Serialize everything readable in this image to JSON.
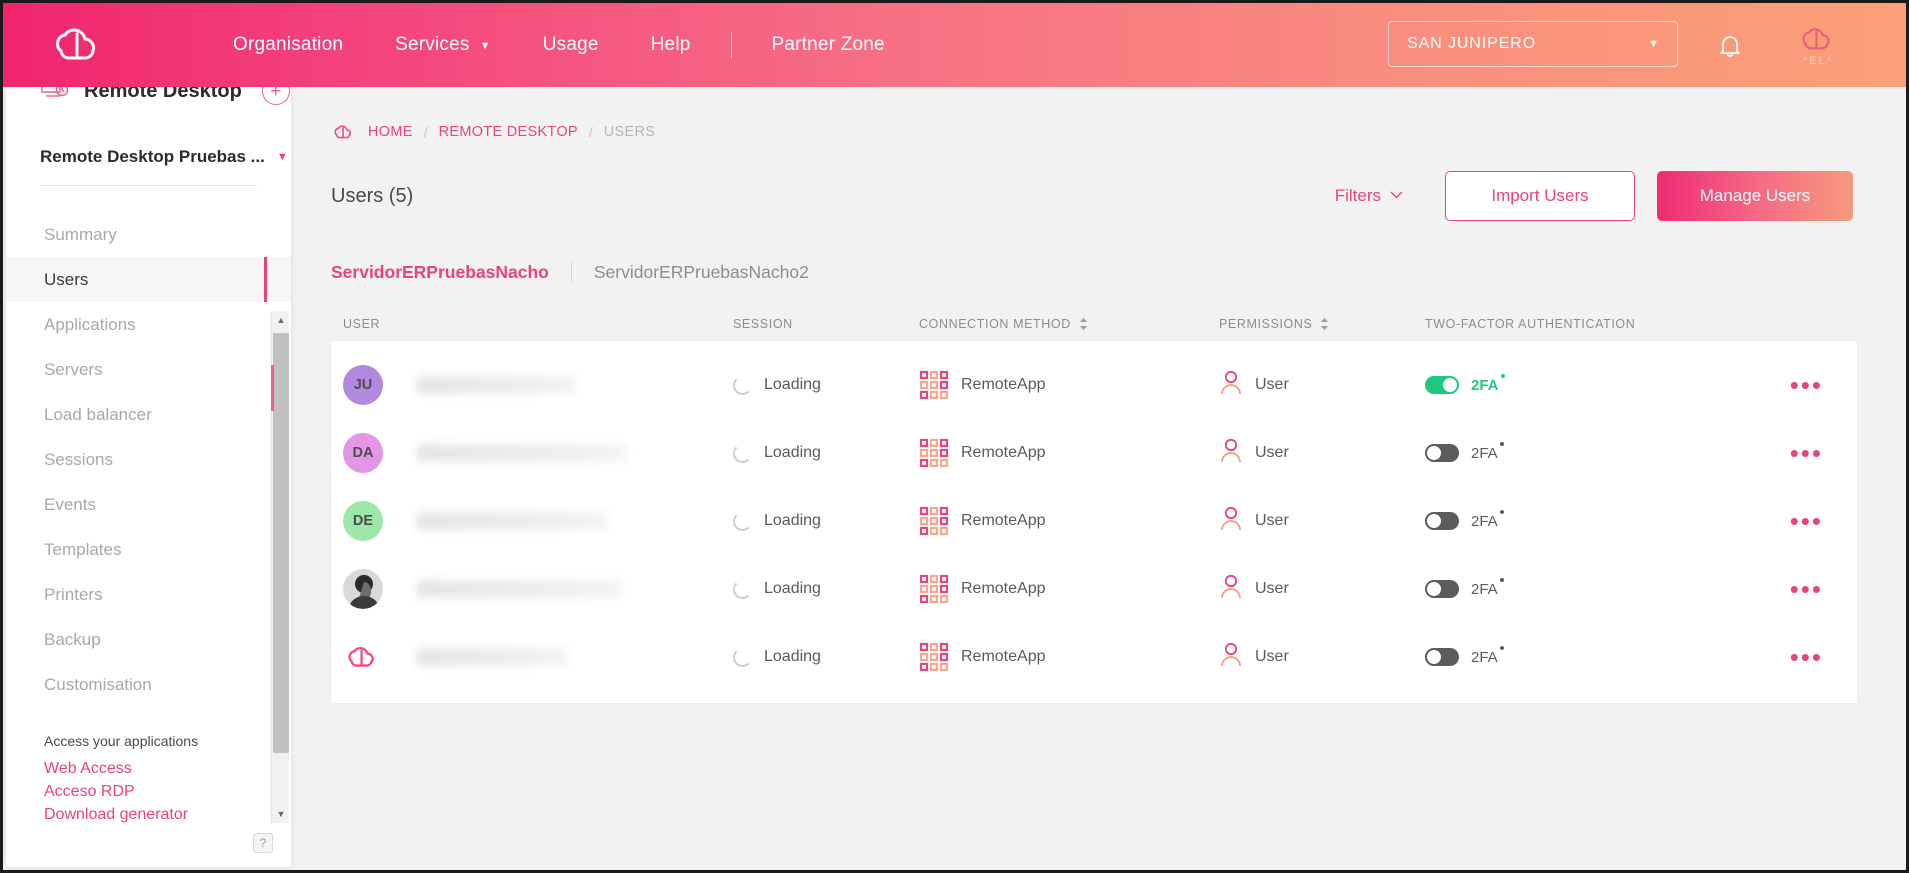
{
  "topbar": {
    "logo_icon": "cloud-logo-icon",
    "nav": [
      {
        "label": "Organisation",
        "caret": false
      },
      {
        "label": "Services",
        "caret": true
      },
      {
        "label": "Usage",
        "caret": false
      },
      {
        "label": "Help",
        "caret": false
      },
      {
        "label": "Partner Zone",
        "caret": false
      }
    ],
    "org_select": {
      "value": "SAN JUNIPERO",
      "caret": "▼"
    },
    "bell_icon": "notification-bell-icon",
    "user": {
      "initials_logo": "cloud-logo-icon",
      "name": "*EL*"
    },
    "gradient_from": "#f0256e",
    "gradient_to": "#fba077"
  },
  "sidebar": {
    "service_icon": "remote-desktop-icon",
    "title": "Remote Desktop",
    "add_label": "+",
    "project": {
      "name": "Remote Desktop Pruebas ...",
      "caret": "▼"
    },
    "items": [
      {
        "label": "Summary",
        "active": false
      },
      {
        "label": "Users",
        "active": true
      },
      {
        "label": "Applications",
        "active": false
      },
      {
        "label": "Servers",
        "active": false
      },
      {
        "label": "Load balancer",
        "active": false
      },
      {
        "label": "Sessions",
        "active": false
      },
      {
        "label": "Events",
        "active": false
      },
      {
        "label": "Templates",
        "active": false
      },
      {
        "label": "Printers",
        "active": false
      },
      {
        "label": "Backup",
        "active": false
      },
      {
        "label": "Customisation",
        "active": false
      }
    ],
    "links_header": "Access your applications",
    "links": [
      {
        "label": "Web Access"
      },
      {
        "label": "Acceso RDP"
      },
      {
        "label": "Download generator"
      }
    ],
    "help_label": "?",
    "scroll_up": "▲",
    "scroll_down": "▼"
  },
  "breadcrumb": {
    "home_icon": "cloud-logo-icon",
    "items": [
      {
        "label": "HOME",
        "current": false
      },
      {
        "label": "REMOTE DESKTOP",
        "current": false
      },
      {
        "label": "USERS",
        "current": true
      }
    ],
    "separator": "/"
  },
  "page": {
    "title": "Users (5)",
    "filters_label": "Filters",
    "filters_chevron": "⌵",
    "import_label": "Import Users",
    "manage_label": "Manage Users"
  },
  "server_tabs": [
    {
      "label": "ServidorERPruebasNacho",
      "active": true
    },
    {
      "label": "ServidorERPruebasNacho2",
      "active": false
    }
  ],
  "table": {
    "columns": [
      {
        "label": "USER",
        "sortable": false
      },
      {
        "label": "SESSION",
        "sortable": false
      },
      {
        "label": "CONNECTION METHOD",
        "sortable": true
      },
      {
        "label": "PERMISSIONS",
        "sortable": true
      },
      {
        "label": "TWO-FACTOR AUTHENTICATION",
        "sortable": false
      }
    ],
    "rows": [
      {
        "avatar": {
          "type": "initials",
          "text": "JU",
          "color": "#b18ae0"
        },
        "username": "",
        "username_redacted": true,
        "session": "Loading",
        "session_icon": "loading-spinner-icon",
        "connection_method": "RemoteApp",
        "connection_icon": "app-grid-icon",
        "permissions": "User",
        "permissions_icon": "user-avatar-icon",
        "two_factor": {
          "enabled": true,
          "label": "2FA"
        },
        "menu": "•••"
      },
      {
        "avatar": {
          "type": "initials",
          "text": "DA",
          "color": "#e396e4"
        },
        "username": "",
        "username_redacted": true,
        "session": "Loading",
        "session_icon": "loading-spinner-icon",
        "connection_method": "RemoteApp",
        "connection_icon": "app-grid-icon",
        "permissions": "User",
        "permissions_icon": "user-avatar-icon",
        "two_factor": {
          "enabled": false,
          "label": "2FA"
        },
        "menu": "•••"
      },
      {
        "avatar": {
          "type": "initials",
          "text": "DE",
          "color": "#9ce8a8"
        },
        "username": "",
        "username_redacted": true,
        "session": "Loading",
        "session_icon": "loading-spinner-icon",
        "connection_method": "RemoteApp",
        "connection_icon": "app-grid-icon",
        "permissions": "User",
        "permissions_icon": "user-avatar-icon",
        "two_factor": {
          "enabled": false,
          "label": "2FA"
        },
        "menu": "•••"
      },
      {
        "avatar": {
          "type": "photo",
          "text": "",
          "color": "#d8d8d8"
        },
        "username": "",
        "username_redacted": true,
        "session": "Loading",
        "session_icon": "loading-spinner-icon",
        "connection_method": "RemoteApp",
        "connection_icon": "app-grid-icon",
        "permissions": "User",
        "permissions_icon": "user-avatar-icon",
        "two_factor": {
          "enabled": false,
          "label": "2FA"
        },
        "menu": "•••"
      },
      {
        "avatar": {
          "type": "logo",
          "text": "",
          "color": "#ef4b7e"
        },
        "username": "",
        "username_redacted": true,
        "session": "Loading",
        "session_icon": "loading-spinner-icon",
        "connection_method": "RemoteApp",
        "connection_icon": "app-grid-icon",
        "permissions": "User",
        "permissions_icon": "user-avatar-icon",
        "two_factor": {
          "enabled": false,
          "label": "2FA"
        },
        "menu": "•••"
      }
    ]
  },
  "colors": {
    "accent_pink": "#e8437a",
    "accent_magenta": "#ef2b74",
    "accent_orange": "#f79b7c",
    "toggle_on": "#1ec97f",
    "toggle_off": "#5c5c5c"
  }
}
